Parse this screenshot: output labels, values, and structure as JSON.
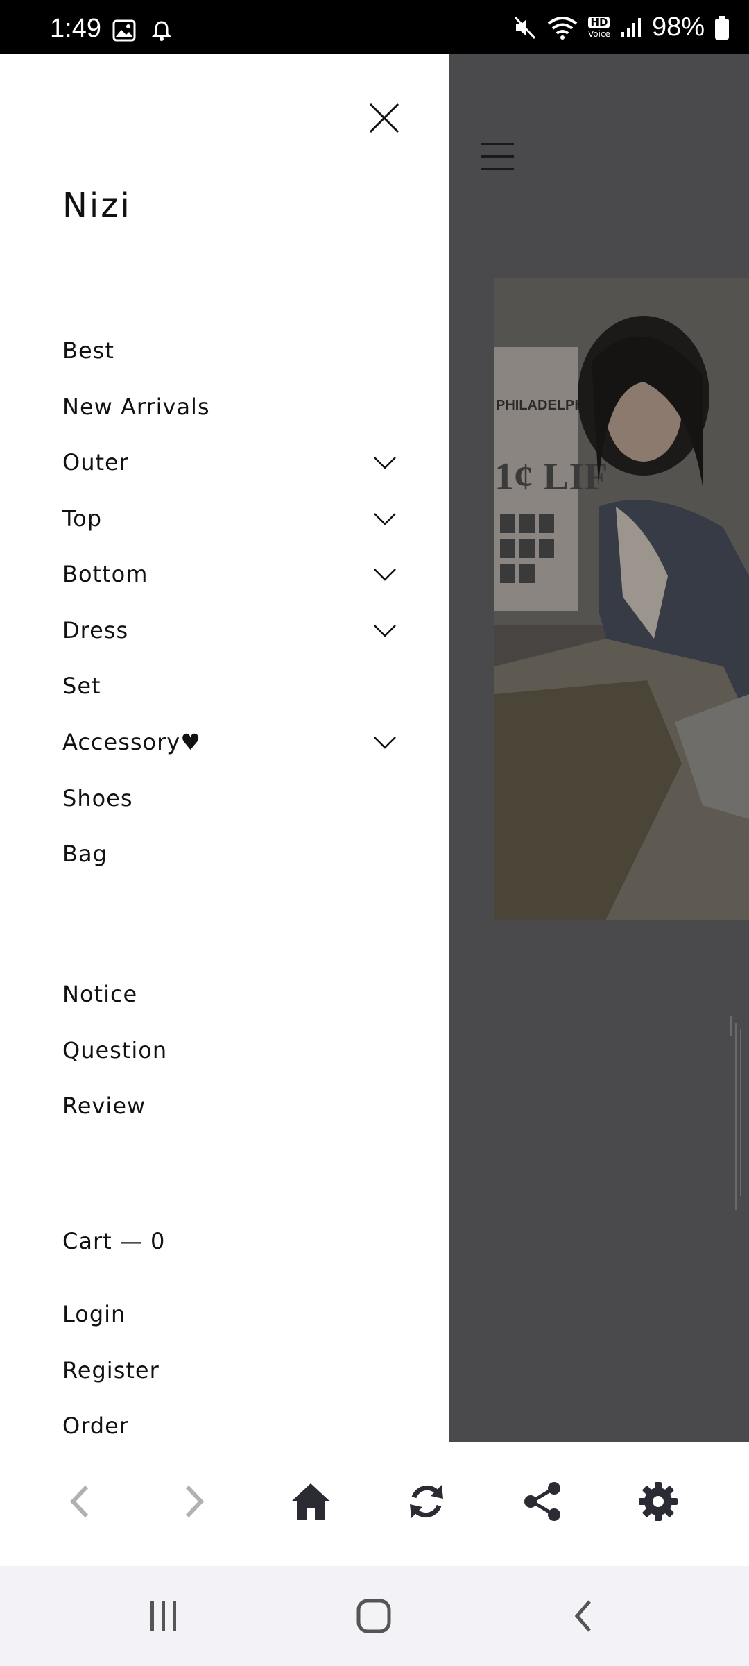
{
  "status_bar": {
    "time": "1:49",
    "battery": "98%",
    "hd_label": "HD",
    "voice_label": "Voice"
  },
  "drawer": {
    "brand": "Nizi",
    "categories": [
      {
        "label": "Best",
        "expandable": false
      },
      {
        "label": "New Arrivals",
        "expandable": false
      },
      {
        "label": "Outer",
        "expandable": true
      },
      {
        "label": "Top",
        "expandable": true
      },
      {
        "label": "Bottom",
        "expandable": true
      },
      {
        "label": "Dress",
        "expandable": true
      },
      {
        "label": "Set",
        "expandable": false
      },
      {
        "label": "Accessory♥",
        "expandable": true
      },
      {
        "label": "Shoes",
        "expandable": false
      },
      {
        "label": "Bag",
        "expandable": false
      }
    ],
    "board": [
      {
        "label": "Notice"
      },
      {
        "label": "Question"
      },
      {
        "label": "Review"
      }
    ],
    "cart": "Cart — 0",
    "account": [
      {
        "label": "Login"
      },
      {
        "label": "Register"
      },
      {
        "label": "Order"
      }
    ]
  },
  "photo_sign": {
    "line1": "PHILADELPHIA MUSEUM",
    "line2": "1¢ LIF"
  },
  "toolbar": {
    "icons": [
      "back-icon",
      "forward-icon",
      "home-icon",
      "refresh-icon",
      "share-icon",
      "settings-icon"
    ]
  },
  "colors": {
    "overlay": "#4a494c",
    "drawer_bg": "#ffffff",
    "text": "#111111",
    "toolbar_icon": "#2b2b33",
    "toolbar_icon_disabled": "#b0b0b5"
  }
}
